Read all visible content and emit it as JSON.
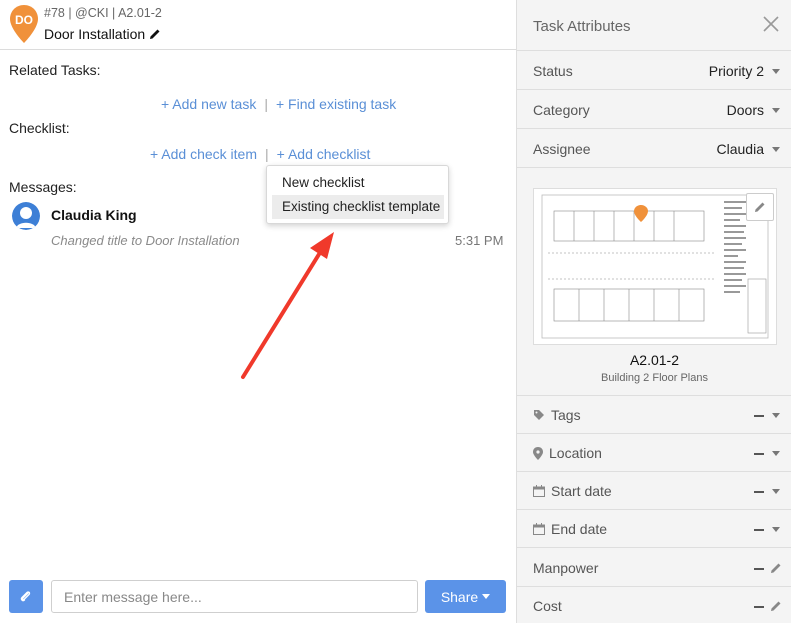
{
  "header": {
    "pin_initials": "DO",
    "meta": "#78 | @CKI | A2.01-2",
    "title": "Door Installation"
  },
  "related": {
    "label": "Related Tasks:",
    "add_new": "+ Add new task",
    "find_existing": "+ Find existing task"
  },
  "checklist": {
    "label": "Checklist:",
    "add_item": "+ Add check item",
    "add_checklist": "+ Add checklist",
    "menu": [
      "New checklist",
      "Existing checklist template"
    ]
  },
  "messages": {
    "label": "Messages:",
    "items": [
      {
        "author": "Claudia King",
        "text": "Changed title to Door Installation",
        "time": "5:31 PM"
      }
    ]
  },
  "composer": {
    "placeholder": "Enter message here...",
    "share_label": "Share"
  },
  "attributes": {
    "title": "Task Attributes",
    "status": {
      "label": "Status",
      "value": "Priority 2"
    },
    "category": {
      "label": "Category",
      "value": "Doors"
    },
    "assignee": {
      "label": "Assignee",
      "value": "Claudia"
    },
    "plan": {
      "name": "A2.01-2",
      "subtitle": "Building 2 Floor Plans"
    },
    "tags": "Tags",
    "location": "Location",
    "start_date": "Start date",
    "end_date": "End date",
    "manpower": "Manpower",
    "cost": "Cost"
  },
  "colors": {
    "accent": "#5b93e8",
    "pin": "#f0913a",
    "annotation_arrow": "#f0392b"
  }
}
